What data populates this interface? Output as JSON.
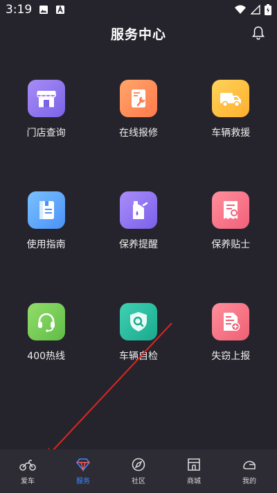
{
  "status": {
    "time": "3:19"
  },
  "header": {
    "title": "服务中心"
  },
  "services": [
    {
      "label": "门店查询",
      "icon": "store-icon",
      "color1": "#a78cf5",
      "color2": "#7b63e8"
    },
    {
      "label": "在线报修",
      "icon": "repair-icon",
      "color1": "#ffa56a",
      "color2": "#ff7a4d"
    },
    {
      "label": "车辆救援",
      "icon": "tow-truck-icon",
      "color1": "#ffd25a",
      "color2": "#ffb02e"
    },
    {
      "label": "使用指南",
      "icon": "guide-book-icon",
      "color1": "#7ac0ff",
      "color2": "#4a92f7"
    },
    {
      "label": "保养提醒",
      "icon": "oil-can-icon",
      "color1": "#a98dfa",
      "color2": "#7a60ea"
    },
    {
      "label": "保养贴士",
      "icon": "tips-receipt-icon",
      "color1": "#ff8f9c",
      "color2": "#f2607a"
    },
    {
      "label": "400热线",
      "icon": "headset-icon",
      "color1": "#93dd6b",
      "color2": "#5fbd45"
    },
    {
      "label": "车辆自检",
      "icon": "shield-search-icon",
      "color1": "#3fd1b3",
      "color2": "#1aa98d"
    },
    {
      "label": "失窃上报",
      "icon": "report-doc-icon",
      "color1": "#ff8f9c",
      "color2": "#ef5f73"
    }
  ],
  "tabbar": {
    "items": [
      {
        "label": "爱车",
        "icon": "motorcycle-icon",
        "active": false
      },
      {
        "label": "服务",
        "icon": "diamond-icon",
        "active": true
      },
      {
        "label": "社区",
        "icon": "compass-icon",
        "active": false
      },
      {
        "label": "商城",
        "icon": "store-icon",
        "active": false
      },
      {
        "label": "我的",
        "icon": "helmet-icon",
        "active": false
      }
    ]
  }
}
